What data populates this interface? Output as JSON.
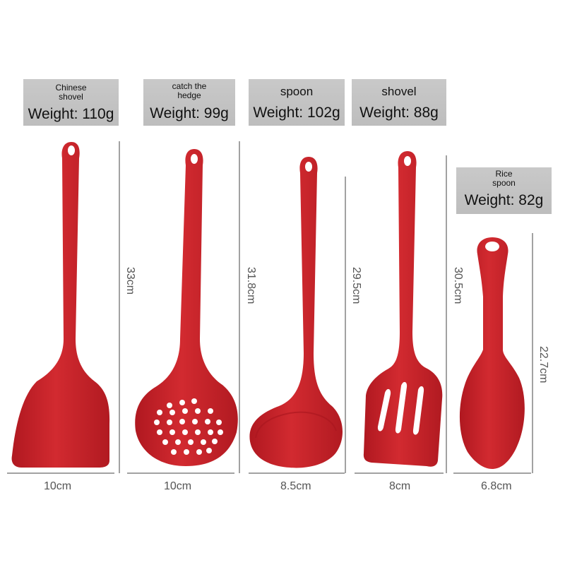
{
  "colors": {
    "utensil": "#c8232b",
    "utensil_shadow": "#a8161e",
    "label_bg": "#c4c4c4"
  },
  "utensils": [
    {
      "name": "Chinese shovel",
      "weight": "Weight: 110g",
      "height": "33cm",
      "width": "10cm"
    },
    {
      "name": "catch the hedge",
      "weight": "Weight: 99g",
      "height": "31.8cm",
      "width": "10cm"
    },
    {
      "name": "spoon",
      "weight": "Weight: 102g",
      "height": "29.5cm",
      "width": "8.5cm"
    },
    {
      "name": "shovel",
      "weight": "Weight: 88g",
      "height": "30.5cm",
      "width": "8cm"
    },
    {
      "name": "Rice spoon",
      "weight": "Weight: 82g",
      "height": "22.7cm",
      "width": "6.8cm"
    }
  ]
}
